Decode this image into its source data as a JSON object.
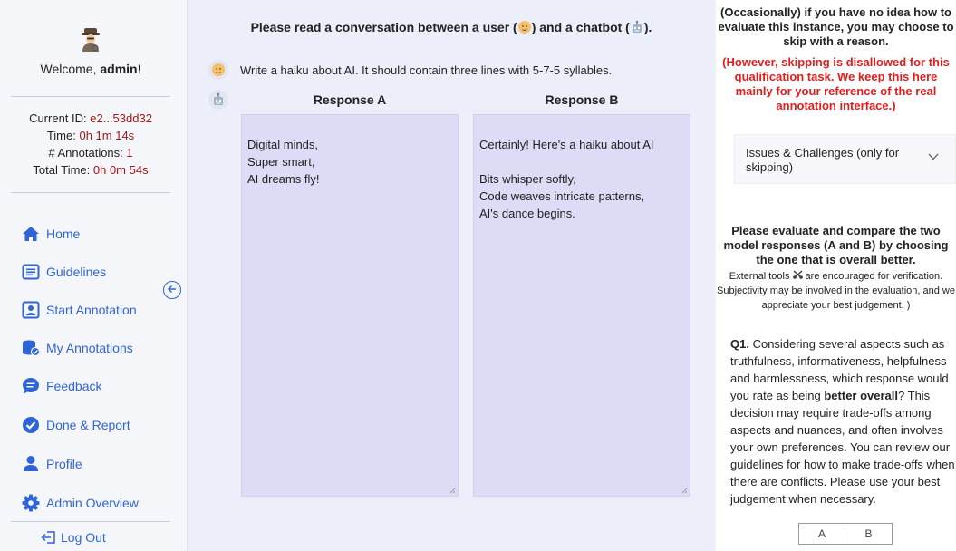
{
  "sidebar": {
    "avatar_icon": "detective-emoji-icon",
    "welcome_prefix": "Welcome, ",
    "username": "admin",
    "welcome_suffix": "!",
    "current_id_label": "Current ID: ",
    "current_id_value": "e2...53dd32",
    "time_label": "Time: ",
    "time_value": "0h 1m 14s",
    "annotations_label": "# Annotations: ",
    "annotations_value": "1",
    "total_time_label": "Total Time: ",
    "total_time_value": "0h 0m 54s",
    "nav": [
      {
        "label": "Home",
        "icon": "home-icon"
      },
      {
        "label": "Guidelines",
        "icon": "guidelines-icon"
      },
      {
        "label": "Start Annotation",
        "icon": "start-annotation-icon"
      },
      {
        "label": "My Annotations",
        "icon": "database-check-icon"
      },
      {
        "label": "Feedback",
        "icon": "feedback-icon"
      },
      {
        "label": "Done & Report",
        "icon": "check-circle-icon"
      },
      {
        "label": "Profile",
        "icon": "person-icon"
      },
      {
        "label": "Admin Overview",
        "icon": "gear-icon"
      }
    ],
    "logout_label": "Log Out",
    "accent_color": "#2f64d6",
    "value_color": "#a01818"
  },
  "main": {
    "title_part1": "Please read a conversation between a user (",
    "title_part2": ") and a chatbot (",
    "title_part3": ").",
    "user_message": "Write a haiku about AI. It should contain three lines with 5-7-5 syllables.",
    "response_a_header": "Response A",
    "response_b_header": "Response B",
    "response_a": "Digital minds,\nSuper smart,\nAI dreams fly!",
    "response_b": "Certainly! Here's a haiku about AI\n\nBits whisper softly,\nCode weaves intricate patterns,\nAI's dance begins."
  },
  "right": {
    "skip_info": "(Occasionally) if you have no idea how to evaluate this instance, you may choose to skip with a reason.",
    "skip_warning": "(However, skipping is disallowed for this qualification task. We keep this here mainly for your reference of the real annotation interface.)",
    "issues_label": "Issues & Challenges (only for skipping)",
    "eval_title": "Please evaluate and compare the two model responses (A and B) by choosing the one that is overall better.",
    "eval_sub_part1": "External tools ",
    "eval_sub_part2": " are encouraged for verification. Subjectivity may be involved in the evaluation, and we appreciate your best judgement. )",
    "q1_label": "Q1.",
    "q1_part1": " Considering several aspects such as truthfulness, informativeness, helpfulness and harmlessness, which response would you rate as being ",
    "q1_bold": "better overall",
    "q1_part2": "? This decision may require trade-offs among aspects and nuances, and often involves your own preferences. You can review our guidelines for how to make trade-offs when there are conflicts. Please use your best judgement when necessary.",
    "option_a": "A",
    "option_b": "B",
    "warning_color": "#e01e1e"
  }
}
